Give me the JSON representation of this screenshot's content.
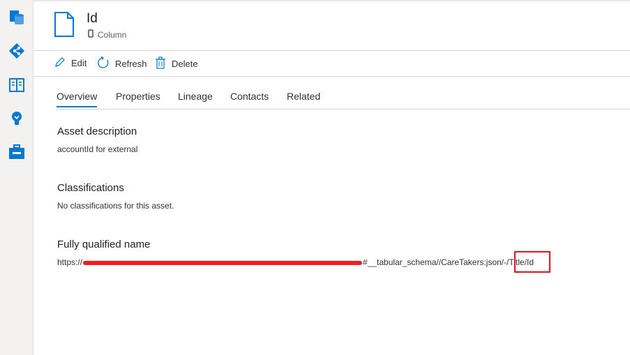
{
  "asset": {
    "title": "Id",
    "type": "Column"
  },
  "toolbar": {
    "edit": "Edit",
    "refresh": "Refresh",
    "delete": "Delete"
  },
  "tabs": [
    "Overview",
    "Properties",
    "Lineage",
    "Contacts",
    "Related"
  ],
  "overview": {
    "description_title": "Asset description",
    "description_text": "accountId for external",
    "classifications_title": "Classifications",
    "classifications_text": "No classifications for this asset.",
    "fqn_title": "Fully qualified name",
    "fqn_prefix": "https://",
    "fqn_suffix": "#__tabular_schema//CareTakers:json/-/Title/Id"
  },
  "colors": {
    "accent": "#0078d4",
    "highlight": "#e81123",
    "redaction": "#ff1a1a"
  },
  "icons": [
    "data-catalog-icon",
    "data-map-icon",
    "glossary-icon",
    "insights-icon",
    "management-icon",
    "document-icon",
    "column-icon",
    "pencil-icon",
    "refresh-icon",
    "trash-icon"
  ]
}
